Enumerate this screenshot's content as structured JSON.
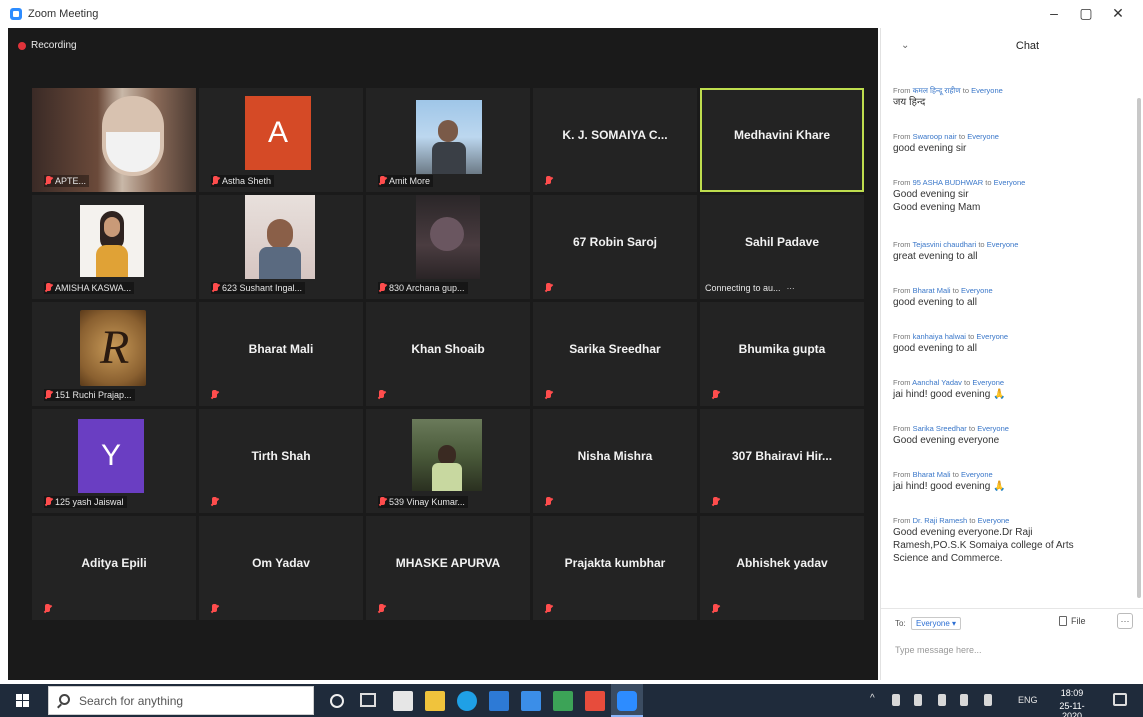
{
  "window": {
    "title": "Zoom Meeting",
    "min": "–",
    "max": "▢",
    "close": "✕"
  },
  "recording": {
    "label": "Recording"
  },
  "participants": [
    {
      "label": "APTE...",
      "type": "video"
    },
    {
      "label": "Astha Sheth",
      "type": "avatar",
      "initial": "A",
      "color": "#d54a26"
    },
    {
      "label": "Amit More",
      "type": "video"
    },
    {
      "name": "K. J. SOMAIYA C...",
      "type": "name"
    },
    {
      "name": "Medhavini Khare",
      "type": "name",
      "active": true
    },
    {
      "label": "AMISHA KASWA...",
      "type": "video"
    },
    {
      "label": "623 Sushant Ingal...",
      "type": "video"
    },
    {
      "label": "830 Archana gup...",
      "type": "video"
    },
    {
      "name": "67 Robin Saroj",
      "type": "name"
    },
    {
      "name": "Sahil Padave",
      "type": "name",
      "status": "Connecting to au..."
    },
    {
      "label": "151 Ruchi Prajap...",
      "type": "video"
    },
    {
      "name": "Bharat Mali",
      "type": "name"
    },
    {
      "name": "Khan Shoaib",
      "type": "name"
    },
    {
      "name": "Sarika Sreedhar",
      "type": "name"
    },
    {
      "name": "Bhumika gupta",
      "type": "name"
    },
    {
      "label": "125 yash Jaiswal",
      "type": "avatar",
      "initial": "Y",
      "color": "#6a3ec2"
    },
    {
      "name": "Tirth Shah",
      "type": "name"
    },
    {
      "label": "539 Vinay Kumar...",
      "type": "video"
    },
    {
      "name": "Nisha Mishra",
      "type": "name"
    },
    {
      "name": "307 Bhairavi Hir...",
      "type": "name"
    },
    {
      "name": "Aditya Epili",
      "type": "name"
    },
    {
      "name": "Om Yadav",
      "type": "name"
    },
    {
      "name": "MHASKE APURVA",
      "type": "name"
    },
    {
      "name": "Prajakta kumbhar",
      "type": "name"
    },
    {
      "name": "Abhishek yadav",
      "type": "name"
    }
  ],
  "chat": {
    "title": "Chat",
    "from_prefix": "From",
    "to_word": "to",
    "messages": [
      {
        "sender": "कमल हिन्दू राहीण",
        "to": "Everyone",
        "lines": [
          "जय हिन्द"
        ]
      },
      {
        "sender": "Swaroop nair",
        "to": "Everyone",
        "lines": [
          "good evening sir"
        ]
      },
      {
        "sender": "95 ASHA BUDHWAR",
        "to": "Everyone",
        "lines": [
          "Good evening sir",
          "Good evening Mam"
        ]
      },
      {
        "sender": "Tejasvini chaudhari",
        "to": "Everyone",
        "lines": [
          "great evening to all"
        ]
      },
      {
        "sender": "Bharat Mali",
        "to": "Everyone",
        "lines": [
          "good evening to all"
        ]
      },
      {
        "sender": "kanhaiya halwai",
        "to": "Everyone",
        "lines": [
          "good evening to all"
        ]
      },
      {
        "sender": "Aanchal Yadav",
        "to": "Everyone",
        "lines": [
          "jai hind! good evening 🙏"
        ]
      },
      {
        "sender": "Sarika Sreedhar",
        "to": "Everyone",
        "lines": [
          "Good evening everyone"
        ]
      },
      {
        "sender": "Bharat Mali",
        "to": "Everyone",
        "lines": [
          "jai hind! good evening 🙏"
        ]
      },
      {
        "sender": "Dr. Raji Ramesh",
        "to": "Everyone",
        "lines": [
          "Good evening everyone.Dr Raji",
          "Ramesh,PO.S.K Somaiya college of Arts",
          "Science and Commerce."
        ]
      }
    ],
    "to_label": "To:",
    "to_value": "Everyone ▾",
    "file_label": "File",
    "more": "···",
    "placeholder": "Type message here..."
  },
  "taskbar": {
    "search_placeholder": "Search for anything",
    "tray_chevron": "^",
    "lang": "ENG",
    "time": "18:09",
    "date": "25-11-2020"
  }
}
